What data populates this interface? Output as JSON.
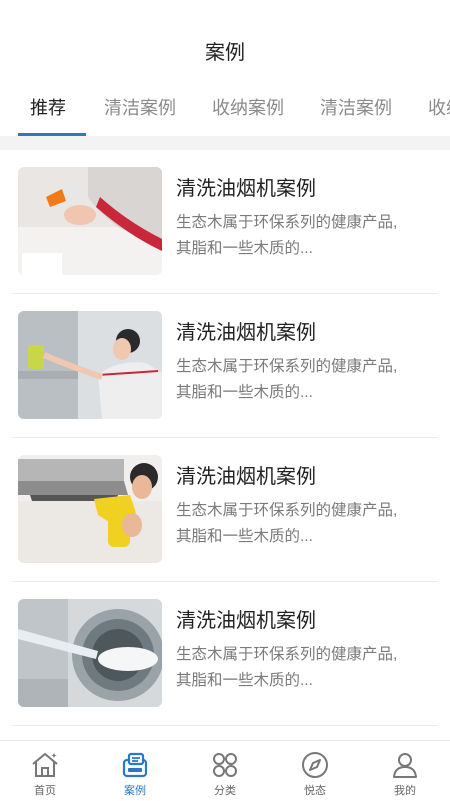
{
  "header": {
    "title": "案例"
  },
  "tabs": [
    {
      "label": "推荐",
      "active": true
    },
    {
      "label": "清洁案例",
      "active": false
    },
    {
      "label": "收纳案例",
      "active": false
    },
    {
      "label": "清洁案例",
      "active": false
    },
    {
      "label": "收纳",
      "active": false
    }
  ],
  "cases": [
    {
      "title": "清洗油烟机案例",
      "desc_line1": "生态木属于环保系列的健康产品,",
      "desc_line2": "其脂和一些木质的..."
    },
    {
      "title": "清洗油烟机案例",
      "desc_line1": "生态木属于环保系列的健康产品,",
      "desc_line2": "其脂和一些木质的..."
    },
    {
      "title": "清洗油烟机案例",
      "desc_line1": "生态木属于环保系列的健康产品,",
      "desc_line2": "其脂和一些木质的..."
    },
    {
      "title": "清洗油烟机案例",
      "desc_line1": "生态木属于环保系列的健康产品,",
      "desc_line2": "其脂和一些木质的..."
    }
  ],
  "nav": [
    {
      "label": "首页",
      "icon": "home-icon",
      "active": false
    },
    {
      "label": "案例",
      "icon": "case-icon",
      "active": true
    },
    {
      "label": "分类",
      "icon": "category-icon",
      "active": false
    },
    {
      "label": "悦态",
      "icon": "compass-icon",
      "active": false
    },
    {
      "label": "我的",
      "icon": "user-icon",
      "active": false
    }
  ],
  "colors": {
    "accent": "#2a78c8",
    "text": "#222222",
    "muted": "#7a7a7a"
  }
}
